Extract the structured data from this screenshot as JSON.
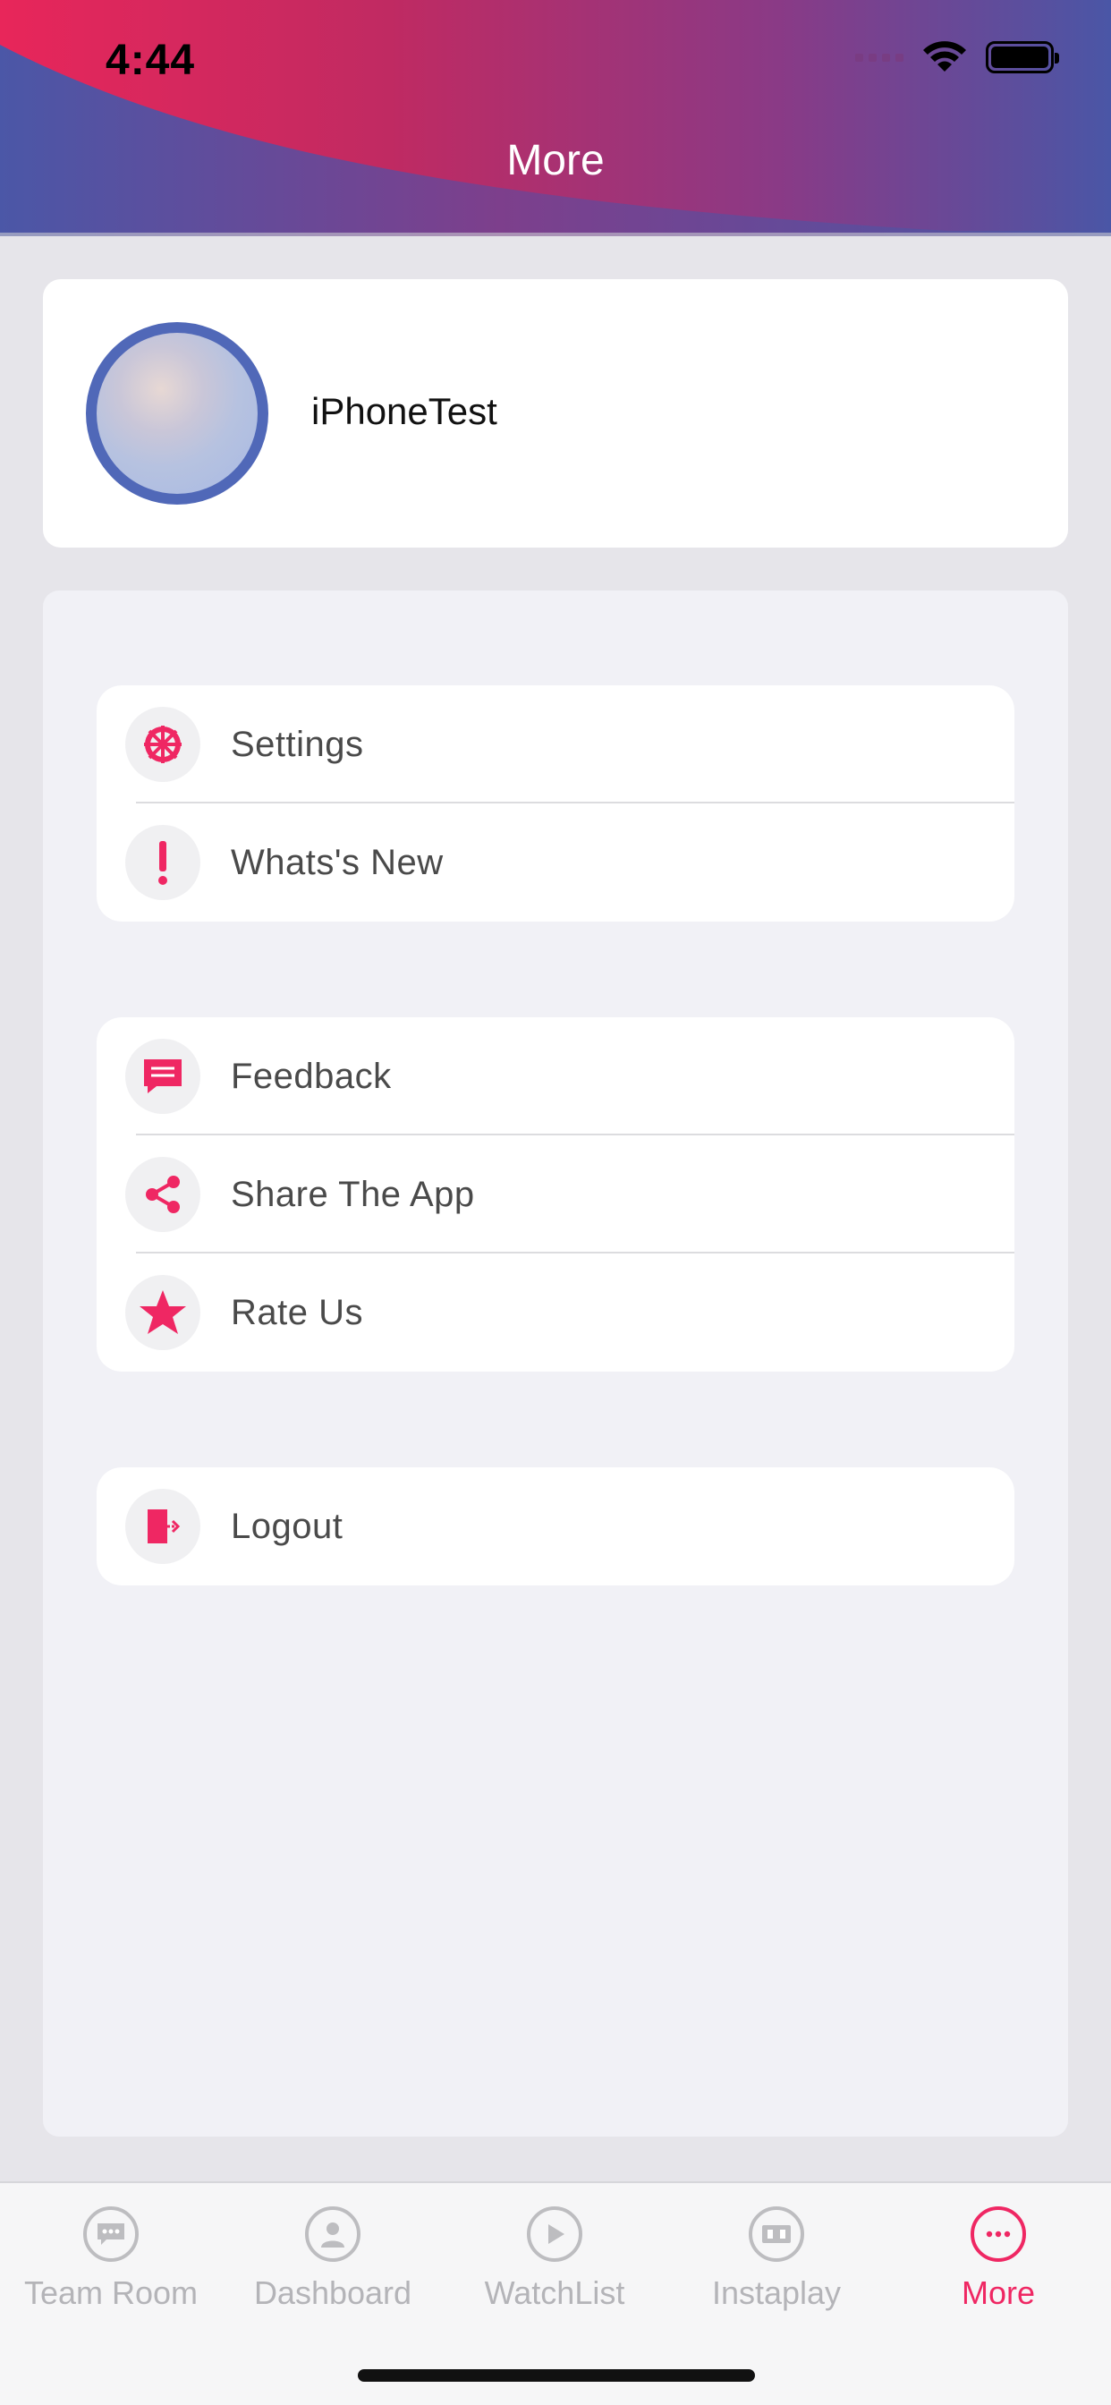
{
  "status_bar": {
    "time": "4:44"
  },
  "header": {
    "title": "More"
  },
  "profile": {
    "name": "iPhoneTest"
  },
  "menu": {
    "group1": [
      {
        "label": "Settings",
        "icon": "gear-icon"
      },
      {
        "label": "Whats's New",
        "icon": "exclamation-icon"
      }
    ],
    "group2": [
      {
        "label": "Feedback",
        "icon": "chat-icon"
      },
      {
        "label": "Share The App",
        "icon": "share-icon"
      },
      {
        "label": "Rate Us",
        "icon": "star-icon"
      }
    ],
    "group3": [
      {
        "label": "Logout",
        "icon": "logout-icon"
      }
    ]
  },
  "tabs": [
    {
      "label": "Team Room",
      "icon": "chat-bubble-icon"
    },
    {
      "label": "Dashboard",
      "icon": "person-icon"
    },
    {
      "label": "WatchList",
      "icon": "play-icon"
    },
    {
      "label": "Instaplay",
      "icon": "scoreboard-icon"
    },
    {
      "label": "More",
      "icon": "more-dots-icon",
      "active": true
    }
  ],
  "colors": {
    "accent": "#ef2763",
    "avatar_ring": "#5068b8",
    "header_left": "#e8265a",
    "header_right": "#4a56a6"
  }
}
